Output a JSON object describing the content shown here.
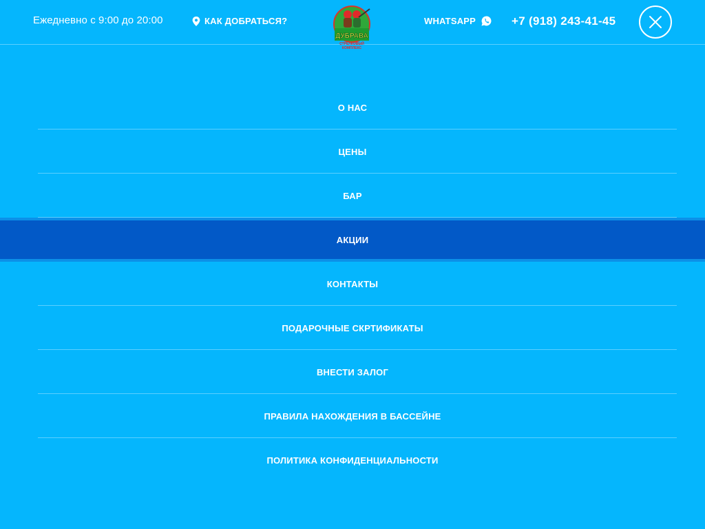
{
  "header": {
    "hours": "Ежедневно с 9:00 до 20:00",
    "route_label": "КАК ДОБРАТЬСЯ?",
    "whatsapp_label": "WHATSAPP",
    "phone": "+7 (918) 243-41-45",
    "logo_text": "ДУБРАВА",
    "logo_subtext": "СТРЕЛКОВЫЙ КОМПЛЕКС"
  },
  "menu": {
    "items": [
      {
        "label": "О НАС"
      },
      {
        "label": "ЦЕНЫ"
      },
      {
        "label": "БАР"
      },
      {
        "label": "АКЦИИ",
        "active": true
      },
      {
        "label": "КОНТАКТЫ"
      },
      {
        "label": "ПОДАРОЧНЫЕ СКРТИФИКАТЫ"
      },
      {
        "label": "ВНЕСТИ ЗАЛОГ"
      },
      {
        "label": "ПРАВИЛА НАХОЖДЕНИЯ В БАССЕЙНЕ"
      },
      {
        "label": "ПОЛИТИКА КОНФИДЕНЦИАЛЬНОСТИ"
      }
    ]
  },
  "colors": {
    "background": "#05b6fd",
    "active_item": "#0259c7",
    "text": "#ffffff",
    "logo_green": "#2fa83a",
    "logo_red": "#e02a2a"
  },
  "icons": {
    "route": "map-pin-icon",
    "whatsapp": "whatsapp-icon",
    "close": "close-icon"
  }
}
